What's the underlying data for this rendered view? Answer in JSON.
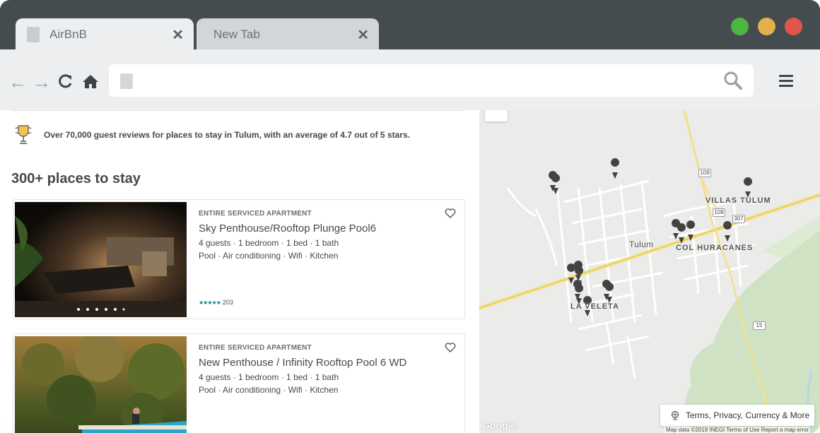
{
  "browser": {
    "tabs": [
      {
        "label": "AirBnB",
        "active": true
      },
      {
        "label": "New Tab",
        "active": false
      }
    ],
    "close_glyph": "✕",
    "window_dots": {
      "green": "#4db640",
      "yellow": "#e5b04c",
      "red": "#e0554d"
    },
    "nav": {
      "back": "←",
      "forward": "→",
      "reload": "C",
      "home": "⌂"
    },
    "address_value": ""
  },
  "listing_page": {
    "reviews_text": "Over 70,000 guest reviews for places to stay in Tulum, with an average of 4.7 out of 5 stars.",
    "heading": "300+ places to stay",
    "cards": [
      {
        "kind": "ENTIRE SERVICED APARTMENT",
        "name": "Sky Penthouse/Rooftop Plunge Pool6",
        "specs": "4 guests · 1 bedroom · 1 bed · 1 bath",
        "amenities": "Pool · Air conditioning · Wifi · Kitchen",
        "stars": "★★★★★",
        "rating": 4.5,
        "review_count": "203"
      },
      {
        "kind": "ENTIRE SERVICED APARTMENT",
        "name": "New Penthouse / Infinity Rooftop Pool 6 WD",
        "specs": "4 guests · 1 bedroom · 1 bed · 1 bath",
        "amenities": "Pool · Air conditioning · Wifi · Kitchen"
      }
    ]
  },
  "map": {
    "labels": {
      "villas_tulum": "VILLAS TULUM",
      "tulum": "Tulum",
      "col_huracanes": "COL HURACANES",
      "la_veleta": "LA VELETA"
    },
    "road_shields": [
      "109",
      "109",
      "307",
      "15"
    ],
    "terms_button": "Terms, Privacy, Currency & More",
    "footer": "Map data ©2019 INEGI   Terms of Use   Report a map error",
    "google": "Google"
  }
}
